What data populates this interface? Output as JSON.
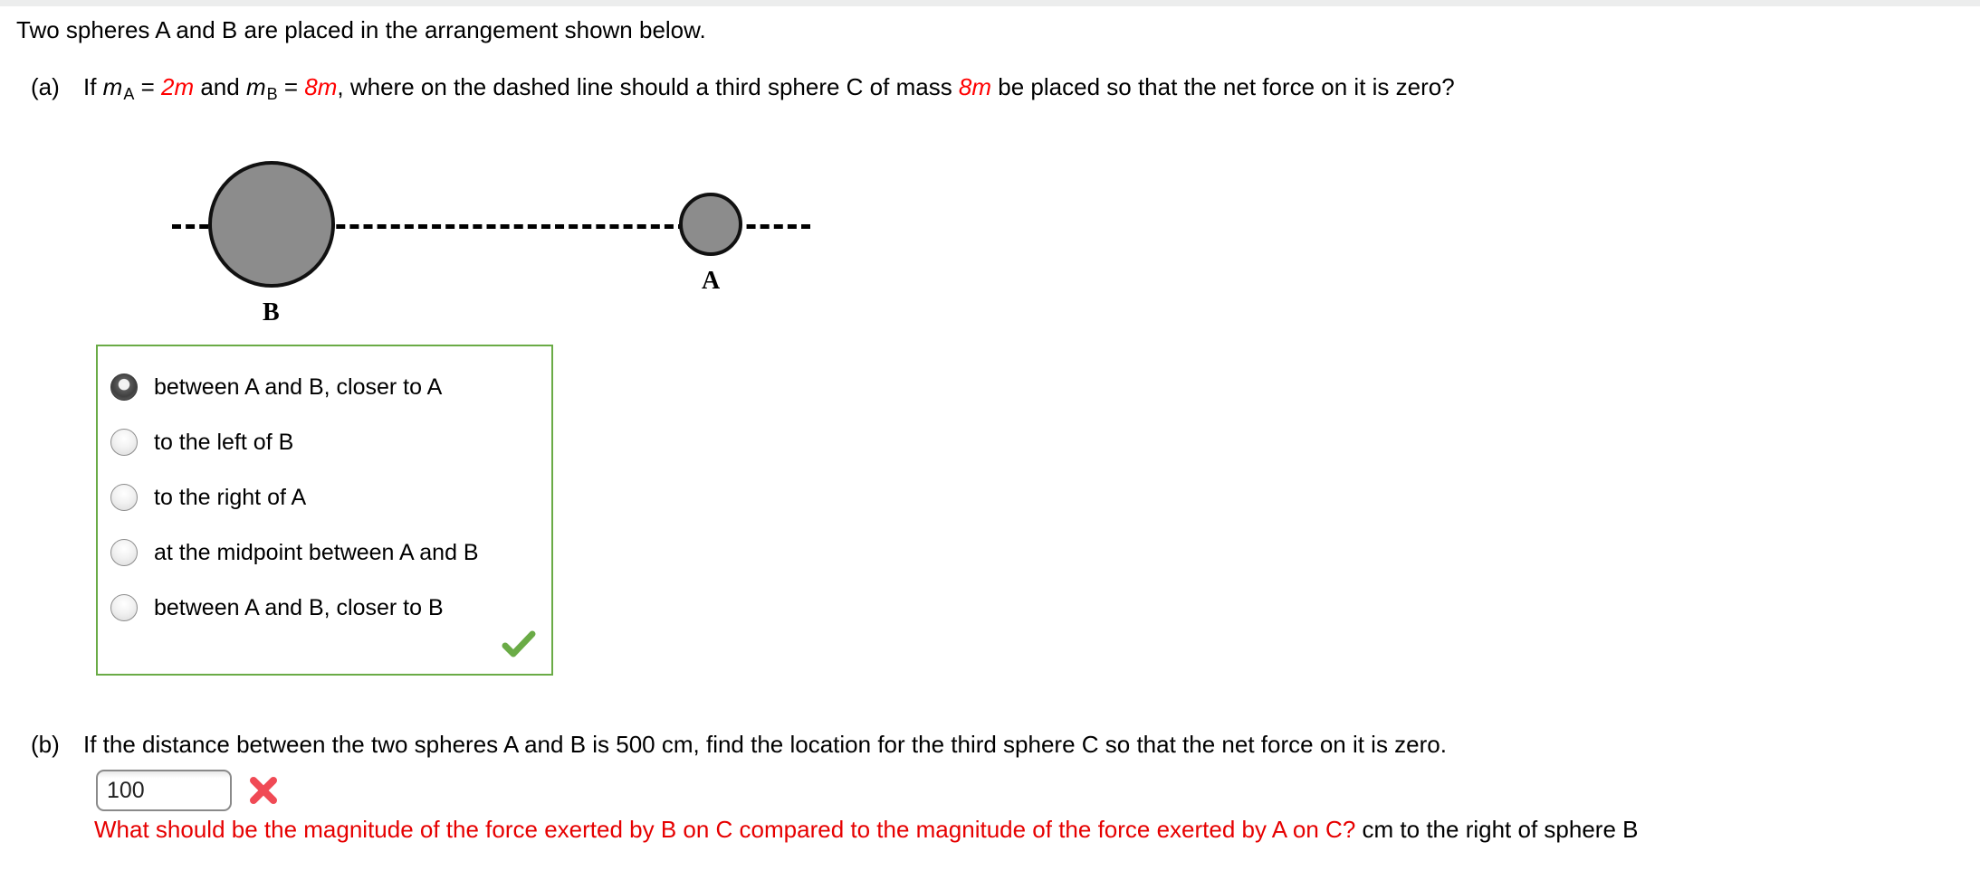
{
  "intro": {
    "text": "Two spheres A and B are placed in the arrangement shown below."
  },
  "part_a": {
    "label": "(a)",
    "text_1": "If ",
    "m_symbol": "m",
    "sub_a": "A",
    "eq_1": " = ",
    "value_a": "2m",
    "and": " and ",
    "sub_b": "B",
    "eq_2": " = ",
    "value_b": "8m",
    "text_2": ", where on the dashed line should a third sphere C of mass ",
    "value_c": "8m",
    "text_3": " be placed so that the net force on it is zero?"
  },
  "diagram": {
    "label_a": "A",
    "label_b": "B",
    "sphere_fill": "#8c8c8c",
    "sphere_stroke": "#111111"
  },
  "options": {
    "selected_index": 0,
    "border_color": "#6aab46",
    "check_color": "#6aab46",
    "items": [
      {
        "label": "between A and B, closer to A"
      },
      {
        "label": "to the left of B"
      },
      {
        "label": "to the right of A"
      },
      {
        "label": "at the midpoint between A and B"
      },
      {
        "label": "between A and B, closer to B"
      }
    ]
  },
  "part_b": {
    "label": "(b)",
    "text": "If the distance between the two spheres A and B is 500 cm, find the location for the third sphere C so that the net force on it is zero.",
    "answer_value": "100",
    "answer_placeholder": "",
    "x_color": "#f04a55"
  },
  "feedback": {
    "question": "What should be the magnitude of the force exerted by B on C compared to the magnitude of the force exerted by A on C?",
    "unit_tail": " cm to the right of sphere B",
    "question_color": "#e60000"
  }
}
